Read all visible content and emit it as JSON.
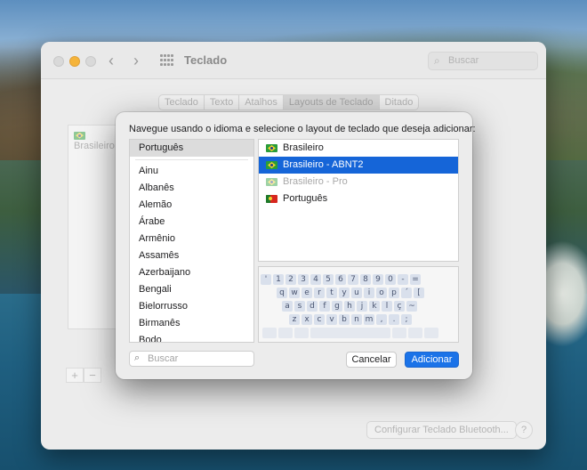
{
  "window": {
    "title": "Teclado",
    "search_placeholder": "Buscar",
    "tabs": [
      "Teclado",
      "Texto",
      "Atalhos",
      "Layouts de Teclado",
      "Ditado"
    ],
    "selected_tab": "Layouts de Teclado",
    "background_list_item": "Brasileiro",
    "bluetooth_button": "Configurar Teclado Bluetooth...",
    "help_button": "?",
    "add_remove": [
      "+",
      "−"
    ]
  },
  "sheet": {
    "prompt": "Navegue usando o idioma e selecione o layout de teclado que deseja adicionar:",
    "languages": {
      "selected": "Português",
      "items": [
        "Ainu",
        "Albanês",
        "Alemão",
        "Árabe",
        "Armênio",
        "Assamês",
        "Azerbaijano",
        "Bengali",
        "Bielorrusso",
        "Birmanês",
        "Bodo"
      ]
    },
    "layouts": [
      {
        "label": "Brasileiro",
        "flag": "br",
        "state": "normal"
      },
      {
        "label": "Brasileiro - ABNT2",
        "flag": "br",
        "state": "selected"
      },
      {
        "label": "Brasileiro - Pro",
        "flag": "br",
        "state": "disabled"
      },
      {
        "label": "Português",
        "flag": "pt",
        "state": "normal"
      }
    ],
    "keyboard_rows": [
      [
        "'",
        "1",
        "2",
        "3",
        "4",
        "5",
        "6",
        "7",
        "8",
        "9",
        "0",
        "-",
        "="
      ],
      [
        "q",
        "w",
        "e",
        "r",
        "t",
        "y",
        "u",
        "i",
        "o",
        "p",
        "´",
        "["
      ],
      [
        "a",
        "s",
        "d",
        "f",
        "g",
        "h",
        "j",
        "k",
        "l",
        "ç",
        "~"
      ],
      [
        "z",
        "x",
        "c",
        "v",
        "b",
        "n",
        "m",
        ",",
        ".",
        ";"
      ]
    ],
    "search_placeholder": "Buscar",
    "cancel_label": "Cancelar",
    "add_label": "Adicionar"
  },
  "colors": {
    "accent": "#1b73e8",
    "selection": "#1565d8"
  }
}
